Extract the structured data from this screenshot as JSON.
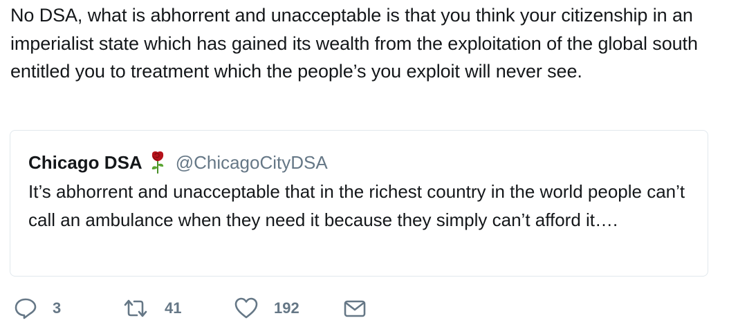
{
  "tweet": {
    "text": "No DSA, what is abhorrent and unacceptable is that you think your citizenship in an imperialist state which has gained its wealth from the exploitation of the global south entitled you to treatment which the people’s you exploit will never see."
  },
  "quoted_tweet": {
    "display_name": "Chicago DSA",
    "handle": "@ChicagoCityDSA",
    "text": "It’s abhorrent and unacceptable that in the richest country in the world people can’t call an ambulance when they need it because they simply can’t afford it….",
    "name_emoji": "rose-icon"
  },
  "actions": {
    "reply": {
      "icon": "reply-icon",
      "count": "3"
    },
    "retweet": {
      "icon": "retweet-icon",
      "count": "41"
    },
    "like": {
      "icon": "heart-icon",
      "count": "192"
    },
    "message": {
      "icon": "envelope-icon"
    }
  },
  "colors": {
    "text": "#14171a",
    "secondary": "#657786",
    "border": "#e1e8ed",
    "rose": "#b5121b"
  }
}
